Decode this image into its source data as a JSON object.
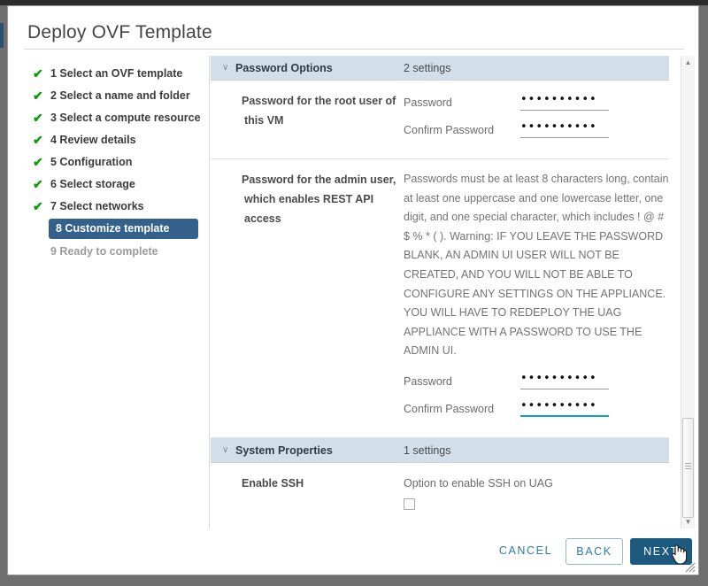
{
  "dialog": {
    "title": "Deploy OVF Template"
  },
  "nav": {
    "items": [
      {
        "label": "1 Select an OVF template",
        "state": "done",
        "check": "✔"
      },
      {
        "label": "2 Select a name and folder",
        "state": "done",
        "check": "✔"
      },
      {
        "label": "3 Select a compute resource",
        "state": "done",
        "check": "✔"
      },
      {
        "label": "4 Review details",
        "state": "done",
        "check": "✔"
      },
      {
        "label": "5 Configuration",
        "state": "done",
        "check": "✔"
      },
      {
        "label": "6 Select storage",
        "state": "done",
        "check": "✔"
      },
      {
        "label": "7 Select networks",
        "state": "done",
        "check": "✔"
      },
      {
        "label": "8 Customize template",
        "state": "selected",
        "check": ""
      },
      {
        "label": "9 Ready to complete",
        "state": "pending",
        "check": ""
      }
    ]
  },
  "sections": [
    {
      "title": "Password Options",
      "count": "2 settings",
      "caret": "∨"
    },
    {
      "title": "System Properties",
      "count": "1 settings",
      "caret": "∨"
    }
  ],
  "properties": {
    "root_password": {
      "label": "Password for the root user of this VM",
      "password_label": "Password",
      "password_value": "••••••••••",
      "confirm_label": "Confirm Password",
      "confirm_value": "••••••••••"
    },
    "admin_password": {
      "label": "Password for the admin user, which enables REST API access",
      "description": "Passwords must be at least 8 characters long, contain at least one uppercase and one lowercase letter, one digit, and one special character, which includes ! @ # $ % * ( ). Warning: IF YOU LEAVE THE PASSWORD BLANK, AN ADMIN UI USER WILL NOT BE CREATED, AND YOU WILL NOT BE ABLE TO CONFIGURE ANY SETTINGS ON THE APPLIANCE. YOU WILL HAVE TO REDEPLOY THE UAG APPLIANCE WITH A PASSWORD TO USE THE ADMIN UI.",
      "password_label": "Password",
      "password_value": "••••••••••",
      "confirm_label": "Confirm Password",
      "confirm_value": "••••••••••"
    },
    "enable_ssh": {
      "label": "Enable SSH",
      "description": "Option to enable SSH on UAG",
      "checked": false
    }
  },
  "scrollbar": {
    "up_arrow": "▲",
    "down_arrow": "▼"
  },
  "footer": {
    "cancel_label": "CANCEL",
    "back_label": "BACK",
    "next_label": "NEXT"
  },
  "colors": {
    "accent": "#1c5a80",
    "selected_nav": "#34618c",
    "section_header": "#d3dfe8",
    "check_green": "#0a9e0a",
    "focus_underline": "#0f9cd6",
    "link_blue": "#2f7ba8"
  }
}
